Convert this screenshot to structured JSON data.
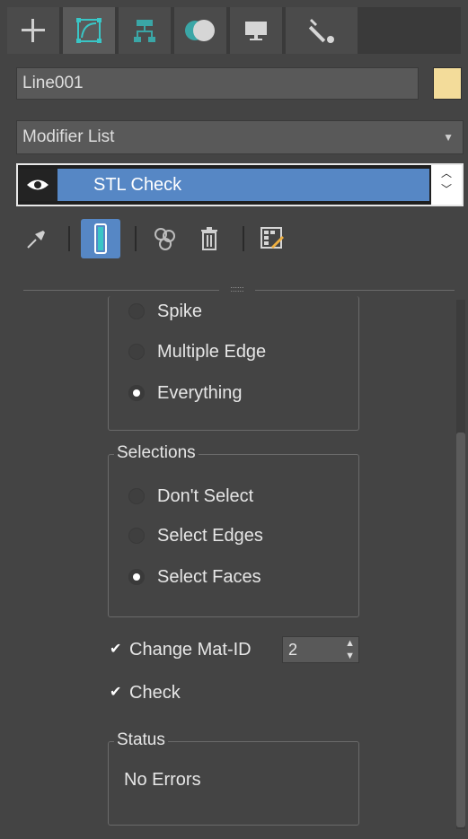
{
  "tabs": [
    {
      "icon": "plus-icon"
    },
    {
      "icon": "modify-curve-icon"
    },
    {
      "icon": "hierarchy-icon"
    },
    {
      "icon": "motion-icon"
    },
    {
      "icon": "display-icon"
    },
    {
      "icon": "wrench-icon"
    }
  ],
  "object": {
    "name": "Line001",
    "color": "#f3dc9a"
  },
  "modifier_list": {
    "label": "Modifier List"
  },
  "stack": {
    "items": [
      {
        "label": "STL Check",
        "visible": true
      }
    ]
  },
  "check_group": {
    "options": [
      {
        "label": "Spike",
        "selected": false
      },
      {
        "label": "Multiple Edge",
        "selected": false
      },
      {
        "label": "Everything",
        "selected": true
      }
    ]
  },
  "selections": {
    "title": "Selections",
    "options": [
      {
        "label": "Don't Select",
        "selected": false
      },
      {
        "label": "Select Edges",
        "selected": false
      },
      {
        "label": "Select Faces",
        "selected": true
      }
    ]
  },
  "change_mat_id": {
    "label": "Change Mat-ID",
    "checked": true,
    "value": "2"
  },
  "check": {
    "label": "Check",
    "checked": true
  },
  "status": {
    "title": "Status",
    "text": "No Errors"
  },
  "colors": {
    "accent": "#5687c5",
    "panel": "#444444"
  }
}
